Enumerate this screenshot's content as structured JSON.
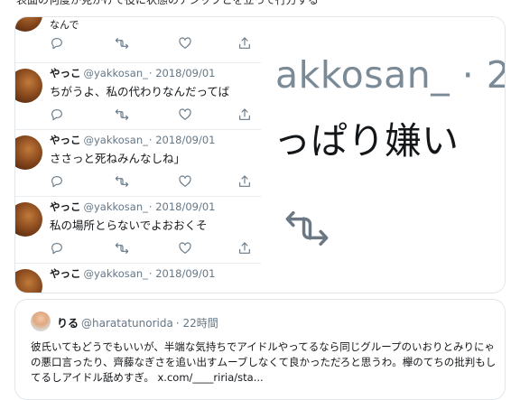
{
  "page": {
    "top_line": "表面の何度か見かけて役に状態のアシップとを立って行方する"
  },
  "quoted": {
    "tweets": [
      {
        "name": "",
        "handle": "",
        "date": "",
        "text": "なんで"
      },
      {
        "name": "やっこ",
        "handle": "@yakkosan_",
        "date": "· 2018/09/01",
        "text": "ちがうよ、私の代わりなんだってば"
      },
      {
        "name": "やっこ",
        "handle": "@yakkosan_",
        "date": "· 2018/09/01",
        "text": "ささっと死ねみんなしね」"
      },
      {
        "name": "やっこ",
        "handle": "@yakkosan_",
        "date": "· 2018/09/01",
        "text": "私の場所とらないでよおおくそ"
      },
      {
        "name": "やっこ",
        "handle": "@yakkosan_",
        "date": "· 2018/09/01",
        "text": ""
      }
    ],
    "zoom": {
      "handle_text": "akkosan_ · 2",
      "body_text": "っぱり嫌い",
      "icon": "retweet-icon"
    },
    "icons": [
      "reply-icon",
      "retweet-icon",
      "like-icon",
      "share-icon"
    ]
  },
  "bottom": {
    "name": "りる",
    "handle": "@haratatunorida",
    "time": "· 22時間",
    "text": "彼氏いてもどうでもいいが、半端な気持ちでアイドルやってるなら同じグループのいおりとみりにゃの悪口言ったり、齊藤なぎさを追い出すムーブしなくて良かっただろと思うわ。欅のてちの批判もしてるしアイドル舐めすぎ。 x.com/____riria/sta..."
  },
  "colors": {
    "border": "#e1e6ea",
    "meta": "#657786",
    "icon": "#657786"
  }
}
